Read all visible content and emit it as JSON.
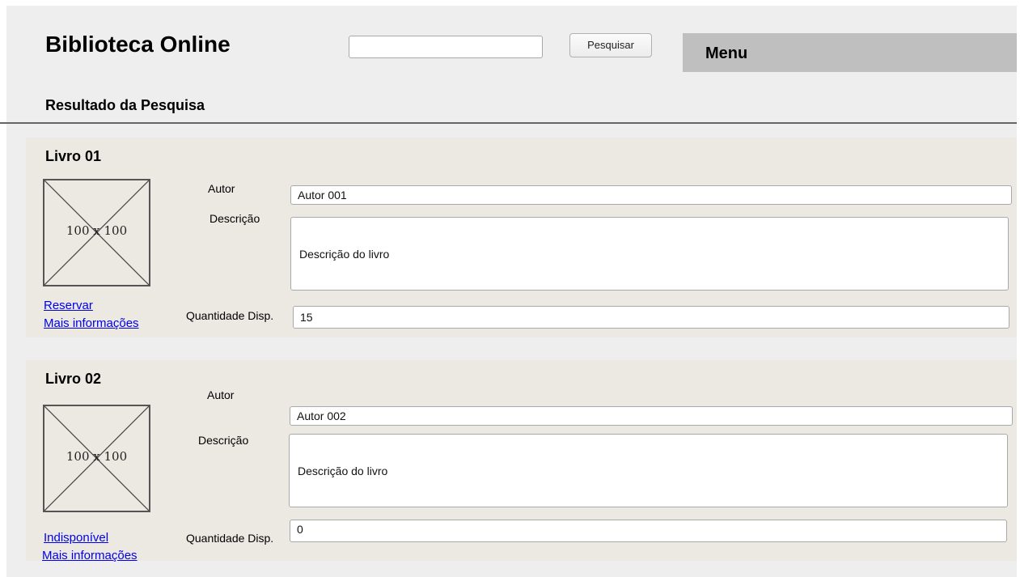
{
  "header": {
    "title": "Biblioteca Online",
    "search": {
      "value": "",
      "placeholder": ""
    },
    "search_button": "Pesquisar",
    "menu_label": "Menu"
  },
  "results": {
    "title": "Resultado da Pesquisa",
    "labels": {
      "author": "Autor",
      "description": "Descrição",
      "quantity": "Quantidade Disp."
    },
    "books": [
      {
        "title": "Livro 01",
        "thumbnail_text": "100 x 100",
        "author": "Autor 001",
        "description": "Descrição do livro",
        "quantity": "15",
        "action_link": "Reservar",
        "info_link": "Mais informações"
      },
      {
        "title": "Livro 02",
        "thumbnail_text": "100 x 100",
        "author": "Autor 002",
        "description": "Descrição do livro",
        "quantity": "0",
        "action_link": "Indisponível",
        "info_link": "Mais informações"
      }
    ]
  }
}
